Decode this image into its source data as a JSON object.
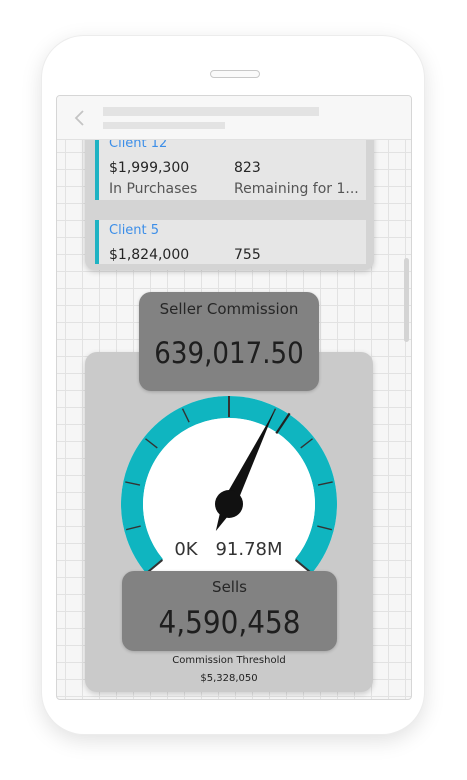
{
  "clients": [
    {
      "name": "Client 12",
      "amount": "$1,999,300",
      "count": "823",
      "label_left": "In Purchases",
      "label_right": "Remaining for 1..."
    },
    {
      "name": "Client 5",
      "amount": "$1,824,000",
      "count": "755"
    }
  ],
  "commission": {
    "label": "Seller Commission",
    "value": "639,017.50"
  },
  "gauge": {
    "min_label": "0K",
    "max_label": "91.78M",
    "min_value": 0,
    "max_value": 91780000,
    "value": 4590458,
    "target_value": 5328050,
    "arc_color": "#0fb5c0",
    "needle_color": "#111111"
  },
  "sells": {
    "label": "Sells",
    "value": "4,590,458"
  },
  "threshold": {
    "label": "Commission Threshold",
    "value": "$5,328,050"
  },
  "colors": {
    "accent": "#1eb3c3",
    "client_name": "#3c8ee8",
    "card_bg": "#cacaca",
    "box_bg": "#828282"
  }
}
